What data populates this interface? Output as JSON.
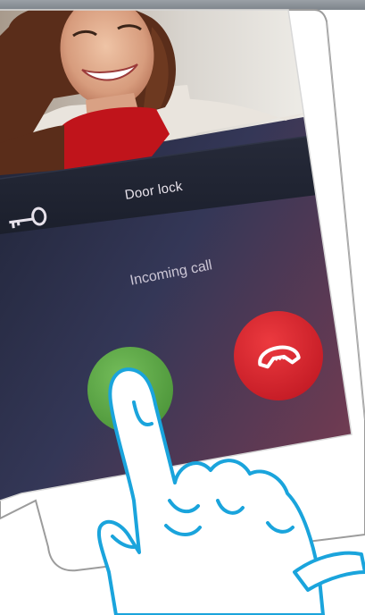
{
  "intercom": {
    "door_lock_label": "Door lock",
    "incoming_call_label": "Incoming call",
    "accept_state": "accept-call",
    "decline_state": "decline-call"
  },
  "icons": {
    "door_lock": "key-icon",
    "accept_call": "phone-icon",
    "decline_call": "phone-hangup-icon"
  },
  "colors": {
    "accept_button": "#5eaa46",
    "decline_button": "#d8232d",
    "finger_outline": "#1aa4dc",
    "screen_top": "#1d2232",
    "screen_bottom": "#7a3c4c"
  }
}
